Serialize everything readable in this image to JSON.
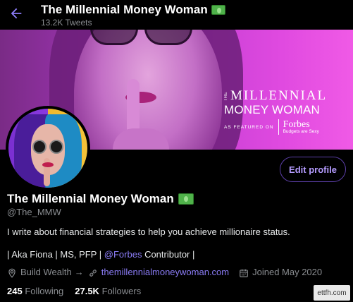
{
  "header": {
    "title": "The Millennial Money Woman",
    "tweets": "13.2K Tweets",
    "back_icon": "arrow-left-icon"
  },
  "banner": {
    "brand_the": "THE",
    "brand_top": "MILLENNIAL",
    "brand_mid": "MONEY WOMAN",
    "brand_featured": "AS FEATURED ON",
    "brand_forbes": "Forbes",
    "brand_tagline": "Budgets are Sexy"
  },
  "profile": {
    "edit_label": "Edit profile",
    "name": "The Millennial Money Woman",
    "handle": "@The_MMW",
    "bio_line1": "I write about financial strategies to help you achieve millionaire status.",
    "bio_prefix": "| Aka Fiona | MS, PFP | ",
    "bio_mention": "@Forbes",
    "bio_suffix": " Contributor |",
    "location": "Build Wealth",
    "location_arrow": "→",
    "website": "themillennialmoneywoman.com",
    "joined": "Joined May 2020",
    "following_count": "245",
    "following_label": "Following",
    "followers_count": "27.5K",
    "followers_label": "Followers"
  },
  "watermark": "ettfh.com",
  "colors": {
    "accent": "#8b7cf6",
    "edit_border": "#5c3fa8",
    "muted": "#8a8d91"
  }
}
